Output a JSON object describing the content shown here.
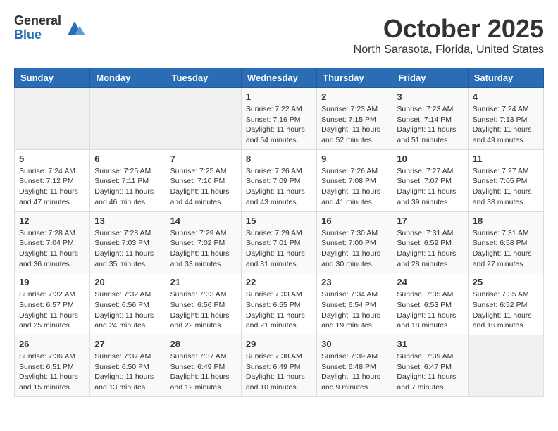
{
  "logo": {
    "general": "General",
    "blue": "Blue"
  },
  "title": "October 2025",
  "location": "North Sarasota, Florida, United States",
  "days_of_week": [
    "Sunday",
    "Monday",
    "Tuesday",
    "Wednesday",
    "Thursday",
    "Friday",
    "Saturday"
  ],
  "weeks": [
    [
      {
        "day": "",
        "info": ""
      },
      {
        "day": "",
        "info": ""
      },
      {
        "day": "",
        "info": ""
      },
      {
        "day": "1",
        "info": "Sunrise: 7:22 AM\nSunset: 7:16 PM\nDaylight: 11 hours\nand 54 minutes."
      },
      {
        "day": "2",
        "info": "Sunrise: 7:23 AM\nSunset: 7:15 PM\nDaylight: 11 hours\nand 52 minutes."
      },
      {
        "day": "3",
        "info": "Sunrise: 7:23 AM\nSunset: 7:14 PM\nDaylight: 11 hours\nand 51 minutes."
      },
      {
        "day": "4",
        "info": "Sunrise: 7:24 AM\nSunset: 7:13 PM\nDaylight: 11 hours\nand 49 minutes."
      }
    ],
    [
      {
        "day": "5",
        "info": "Sunrise: 7:24 AM\nSunset: 7:12 PM\nDaylight: 11 hours\nand 47 minutes."
      },
      {
        "day": "6",
        "info": "Sunrise: 7:25 AM\nSunset: 7:11 PM\nDaylight: 11 hours\nand 46 minutes."
      },
      {
        "day": "7",
        "info": "Sunrise: 7:25 AM\nSunset: 7:10 PM\nDaylight: 11 hours\nand 44 minutes."
      },
      {
        "day": "8",
        "info": "Sunrise: 7:26 AM\nSunset: 7:09 PM\nDaylight: 11 hours\nand 43 minutes."
      },
      {
        "day": "9",
        "info": "Sunrise: 7:26 AM\nSunset: 7:08 PM\nDaylight: 11 hours\nand 41 minutes."
      },
      {
        "day": "10",
        "info": "Sunrise: 7:27 AM\nSunset: 7:07 PM\nDaylight: 11 hours\nand 39 minutes."
      },
      {
        "day": "11",
        "info": "Sunrise: 7:27 AM\nSunset: 7:05 PM\nDaylight: 11 hours\nand 38 minutes."
      }
    ],
    [
      {
        "day": "12",
        "info": "Sunrise: 7:28 AM\nSunset: 7:04 PM\nDaylight: 11 hours\nand 36 minutes."
      },
      {
        "day": "13",
        "info": "Sunrise: 7:28 AM\nSunset: 7:03 PM\nDaylight: 11 hours\nand 35 minutes."
      },
      {
        "day": "14",
        "info": "Sunrise: 7:29 AM\nSunset: 7:02 PM\nDaylight: 11 hours\nand 33 minutes."
      },
      {
        "day": "15",
        "info": "Sunrise: 7:29 AM\nSunset: 7:01 PM\nDaylight: 11 hours\nand 31 minutes."
      },
      {
        "day": "16",
        "info": "Sunrise: 7:30 AM\nSunset: 7:00 PM\nDaylight: 11 hours\nand 30 minutes."
      },
      {
        "day": "17",
        "info": "Sunrise: 7:31 AM\nSunset: 6:59 PM\nDaylight: 11 hours\nand 28 minutes."
      },
      {
        "day": "18",
        "info": "Sunrise: 7:31 AM\nSunset: 6:58 PM\nDaylight: 11 hours\nand 27 minutes."
      }
    ],
    [
      {
        "day": "19",
        "info": "Sunrise: 7:32 AM\nSunset: 6:57 PM\nDaylight: 11 hours\nand 25 minutes."
      },
      {
        "day": "20",
        "info": "Sunrise: 7:32 AM\nSunset: 6:56 PM\nDaylight: 11 hours\nand 24 minutes."
      },
      {
        "day": "21",
        "info": "Sunrise: 7:33 AM\nSunset: 6:56 PM\nDaylight: 11 hours\nand 22 minutes."
      },
      {
        "day": "22",
        "info": "Sunrise: 7:33 AM\nSunset: 6:55 PM\nDaylight: 11 hours\nand 21 minutes."
      },
      {
        "day": "23",
        "info": "Sunrise: 7:34 AM\nSunset: 6:54 PM\nDaylight: 11 hours\nand 19 minutes."
      },
      {
        "day": "24",
        "info": "Sunrise: 7:35 AM\nSunset: 6:53 PM\nDaylight: 11 hours\nand 18 minutes."
      },
      {
        "day": "25",
        "info": "Sunrise: 7:35 AM\nSunset: 6:52 PM\nDaylight: 11 hours\nand 16 minutes."
      }
    ],
    [
      {
        "day": "26",
        "info": "Sunrise: 7:36 AM\nSunset: 6:51 PM\nDaylight: 11 hours\nand 15 minutes."
      },
      {
        "day": "27",
        "info": "Sunrise: 7:37 AM\nSunset: 6:50 PM\nDaylight: 11 hours\nand 13 minutes."
      },
      {
        "day": "28",
        "info": "Sunrise: 7:37 AM\nSunset: 6:49 PM\nDaylight: 11 hours\nand 12 minutes."
      },
      {
        "day": "29",
        "info": "Sunrise: 7:38 AM\nSunset: 6:49 PM\nDaylight: 11 hours\nand 10 minutes."
      },
      {
        "day": "30",
        "info": "Sunrise: 7:39 AM\nSunset: 6:48 PM\nDaylight: 11 hours\nand 9 minutes."
      },
      {
        "day": "31",
        "info": "Sunrise: 7:39 AM\nSunset: 6:47 PM\nDaylight: 11 hours\nand 7 minutes."
      },
      {
        "day": "",
        "info": ""
      }
    ]
  ]
}
